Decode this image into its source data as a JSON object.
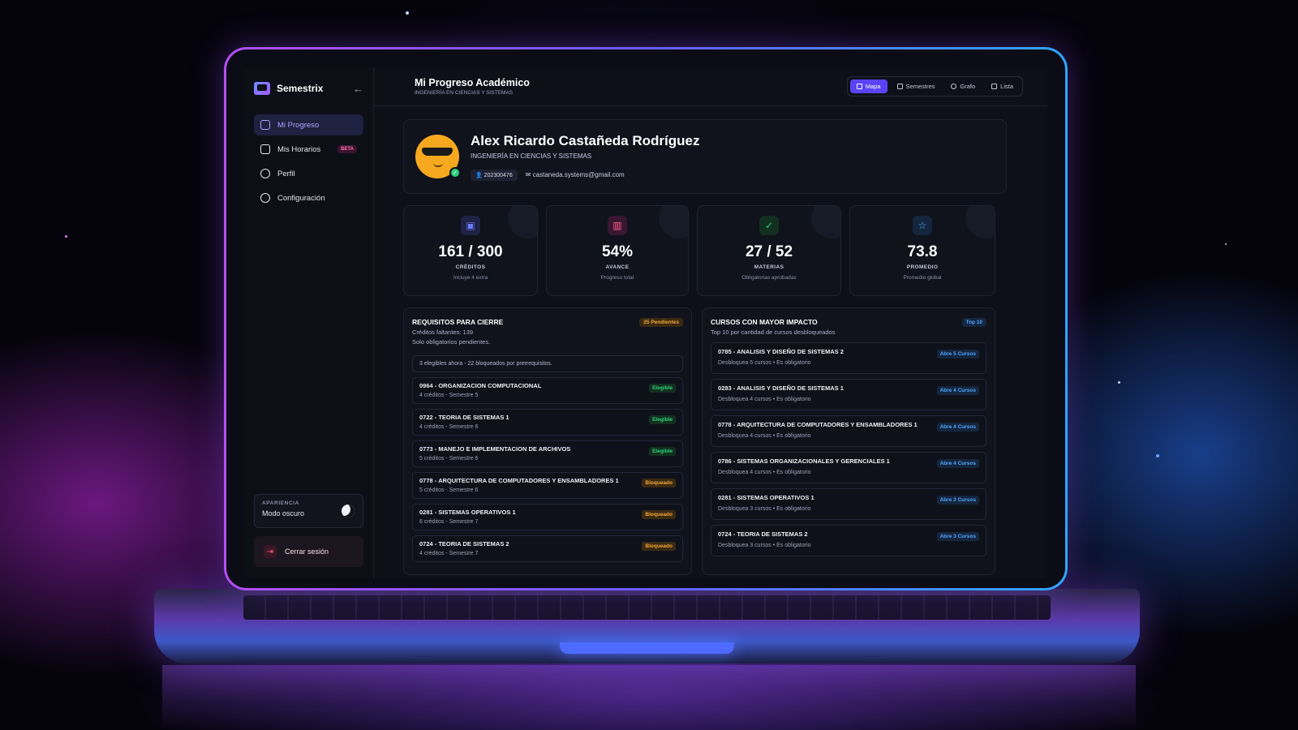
{
  "app": {
    "name": "Semestrix"
  },
  "sidebar": {
    "items": [
      {
        "label": "Mi Progreso",
        "active": true
      },
      {
        "label": "Mis Horarios",
        "badge": "BETA"
      },
      {
        "label": "Perfil"
      },
      {
        "label": "Configuración"
      }
    ],
    "appearance": {
      "label": "APARIENCIA",
      "value": "Modo oscuro"
    },
    "logout_label": "Cerrar sesión"
  },
  "header": {
    "title": "Mi Progreso Académico",
    "subtitle": "INGENIERÍA EN CIENCIAS Y SISTEMAS",
    "tabs": [
      {
        "label": "Mapa",
        "active": true,
        "icon": "grid-icon"
      },
      {
        "label": "Semestres",
        "icon": "calendar-icon"
      },
      {
        "label": "Grafo",
        "icon": "share-icon"
      },
      {
        "label": "Lista",
        "icon": "list-icon"
      }
    ]
  },
  "profile": {
    "name": "Alex Ricardo Castañeda Rodríguez",
    "career": "INGENIERÍA EN CIENCIAS Y SISTEMAS",
    "id": "202300476",
    "email": "castaneda.systems@gmail.com"
  },
  "stats": [
    {
      "value": "161 / 300",
      "label": "CRÉDITOS",
      "desc": "Incluye 4 extra",
      "color": "#6c7cff",
      "icon": "id-card-icon"
    },
    {
      "value": "54%",
      "label": "AVANCE",
      "desc": "Progreso total",
      "color": "#ff5f8f",
      "icon": "bar-chart-icon"
    },
    {
      "value": "27 / 52",
      "label": "MATERIAS",
      "desc": "Obligatorias aprobadas",
      "color": "#2fd07b",
      "icon": "check-circle-icon"
    },
    {
      "value": "73.8",
      "label": "PROMEDIO",
      "desc": "Promedio global",
      "color": "#3fb8ff",
      "icon": "star-icon"
    }
  ],
  "requirements": {
    "title": "REQUISITOS PARA CIERRE",
    "badge": "25 Pendientes",
    "line1": "Créditos faltantes: 139",
    "line2": "Solo obligatorios pendientes.",
    "info": "3 elegibles ahora - 22 bloqueados por prerrequisitos.",
    "rows": [
      {
        "title": "0964 - ORGANIZACION COMPUTACIONAL",
        "sub": "4 créditos - Semestre 5",
        "status": "Elegible",
        "kind": "ok"
      },
      {
        "title": "0722 - TEORIA DE SISTEMAS 1",
        "sub": "4 créditos - Semestre 6",
        "status": "Elegible",
        "kind": "ok"
      },
      {
        "title": "0773 - MANEJO E IMPLEMENTACION DE ARCHIVOS",
        "sub": "5 créditos - Semestre 6",
        "status": "Elegible",
        "kind": "ok"
      },
      {
        "title": "0778 - ARQUITECTURA DE COMPUTADORES Y ENSAMBLADORES 1",
        "sub": "5 créditos - Semestre 6",
        "status": "Bloqueado",
        "kind": "blocked"
      },
      {
        "title": "0281 - SISTEMAS OPERATIVOS 1",
        "sub": "6 créditos - Semestre 7",
        "status": "Bloqueado",
        "kind": "blocked"
      },
      {
        "title": "0724 - TEORIA DE SISTEMAS 2",
        "sub": "4 créditos - Semestre 7",
        "status": "Bloqueado",
        "kind": "blocked"
      }
    ]
  },
  "impact": {
    "title": "CURSOS CON MAYOR IMPACTO",
    "badge": "Top 10",
    "subtitle": "Top 10 por cantidad de cursos desbloqueados",
    "rows": [
      {
        "title": "0785 - ANALISIS Y DISEÑO DE SISTEMAS 2",
        "sub": "Desbloquea 5 cursos • Es obligatorio",
        "tag": "Abre 5 Cursos"
      },
      {
        "title": "0283 - ANALISIS Y DISEÑO DE SISTEMAS 1",
        "sub": "Desbloquea 4 cursos • Es obligatorio",
        "tag": "Abre 4 Cursos"
      },
      {
        "title": "0778 - ARQUITECTURA DE COMPUTADORES Y ENSAMBLADORES 1",
        "sub": "Desbloquea 4 cursos • Es obligatorio",
        "tag": "Abre 4 Cursos"
      },
      {
        "title": "0786 - SISTEMAS ORGANIZACIONALES Y GERENCIALES 1",
        "sub": "Desbloquea 4 cursos • Es obligatorio",
        "tag": "Abre 4 Cursos"
      },
      {
        "title": "0281 - SISTEMAS OPERATIVOS 1",
        "sub": "Desbloquea 3 cursos • Es obligatorio",
        "tag": "Abre 3 Cursos"
      },
      {
        "title": "0724 - TEORIA DE SISTEMAS 2",
        "sub": "Desbloquea 3 cursos • Es obligatorio",
        "tag": "Abre 3 Cursos"
      }
    ]
  }
}
